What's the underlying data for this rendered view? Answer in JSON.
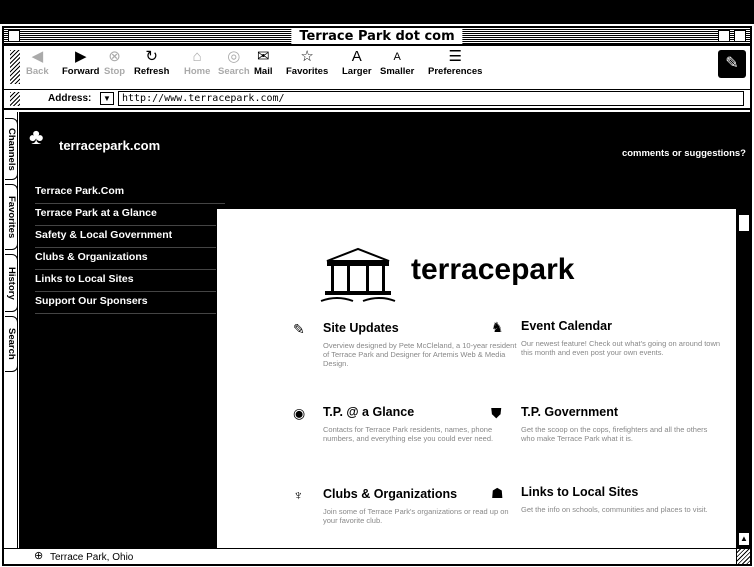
{
  "window": {
    "title": "Terrace Park dot com"
  },
  "toolbar": {
    "buttons": [
      {
        "label": "Back",
        "icon": "back-arrow-icon",
        "glyph": "◀",
        "enabled": false
      },
      {
        "label": "Forward",
        "icon": "forward-arrow-icon",
        "glyph": "▶",
        "enabled": true
      },
      {
        "label": "Stop",
        "icon": "stop-icon",
        "glyph": "⊗",
        "enabled": false
      },
      {
        "label": "Refresh",
        "icon": "refresh-icon",
        "glyph": "↻",
        "enabled": true
      },
      {
        "label": "Home",
        "icon": "home-icon",
        "glyph": "⌂",
        "enabled": false
      },
      {
        "label": "Search",
        "icon": "search-icon",
        "glyph": "◎",
        "enabled": false
      },
      {
        "label": "Mail",
        "icon": "mail-icon",
        "glyph": "✉",
        "enabled": true
      },
      {
        "label": "Favorites",
        "icon": "favorites-icon",
        "glyph": "☆",
        "enabled": true
      },
      {
        "label": "Larger",
        "icon": "larger-text-icon",
        "glyph": "A",
        "enabled": true
      },
      {
        "label": "Smaller",
        "icon": "smaller-text-icon",
        "glyph": "A",
        "enabled": true
      },
      {
        "label": "Preferences",
        "icon": "preferences-icon",
        "glyph": "☰",
        "enabled": true
      }
    ]
  },
  "address": {
    "label": "Address:",
    "url": "http://www.terracepark.com/"
  },
  "side_tabs": [
    "Channels",
    "Favorites",
    "History",
    "Search"
  ],
  "site": {
    "logo_text": "terracepark.com",
    "comments_link": "comments or suggestions?",
    "nav": [
      "Terrace Park.Com",
      "Terrace Park at a Glance",
      "Safety & Local Government",
      "Clubs & Organizations",
      "Links to Local Sites",
      "Support Our Sponsers"
    ],
    "brand_text": "terracepark",
    "cards": [
      {
        "title": "Site Updates",
        "icon": "pencil-icon",
        "glyph": "✎",
        "body": "Overview designed by Pete McCleland, a 10-year resident of Terrace Park and Designer for Artemis Web & Media Design."
      },
      {
        "title": "Event Calendar",
        "icon": "runner-icon",
        "glyph": "♞",
        "body": "Our newest feature! Check out what's going on around town this month and even post your own events."
      },
      {
        "title": "T.P. @ a Glance",
        "icon": "eye-icon",
        "glyph": "◉",
        "body": "Contacts for Terrace Park residents, names, phone numbers, and everything else you could ever need."
      },
      {
        "title": "T.P. Government",
        "icon": "shield-icon",
        "glyph": "⛊",
        "body": "Get the scoop on the cops, firefighters and all the others who make Terrace Park what it is."
      },
      {
        "title": "Clubs & Organizations",
        "icon": "trophy-icon",
        "glyph": "♆",
        "body": "Join some of Terrace Park's organizations or read up on your favorite club."
      },
      {
        "title": "Links to Local Sites",
        "icon": "ohio-map-icon",
        "glyph": "☗",
        "body": "Get the info on schools, communities and places to visit."
      }
    ]
  },
  "status": {
    "text": "Terrace Park, Ohio"
  }
}
